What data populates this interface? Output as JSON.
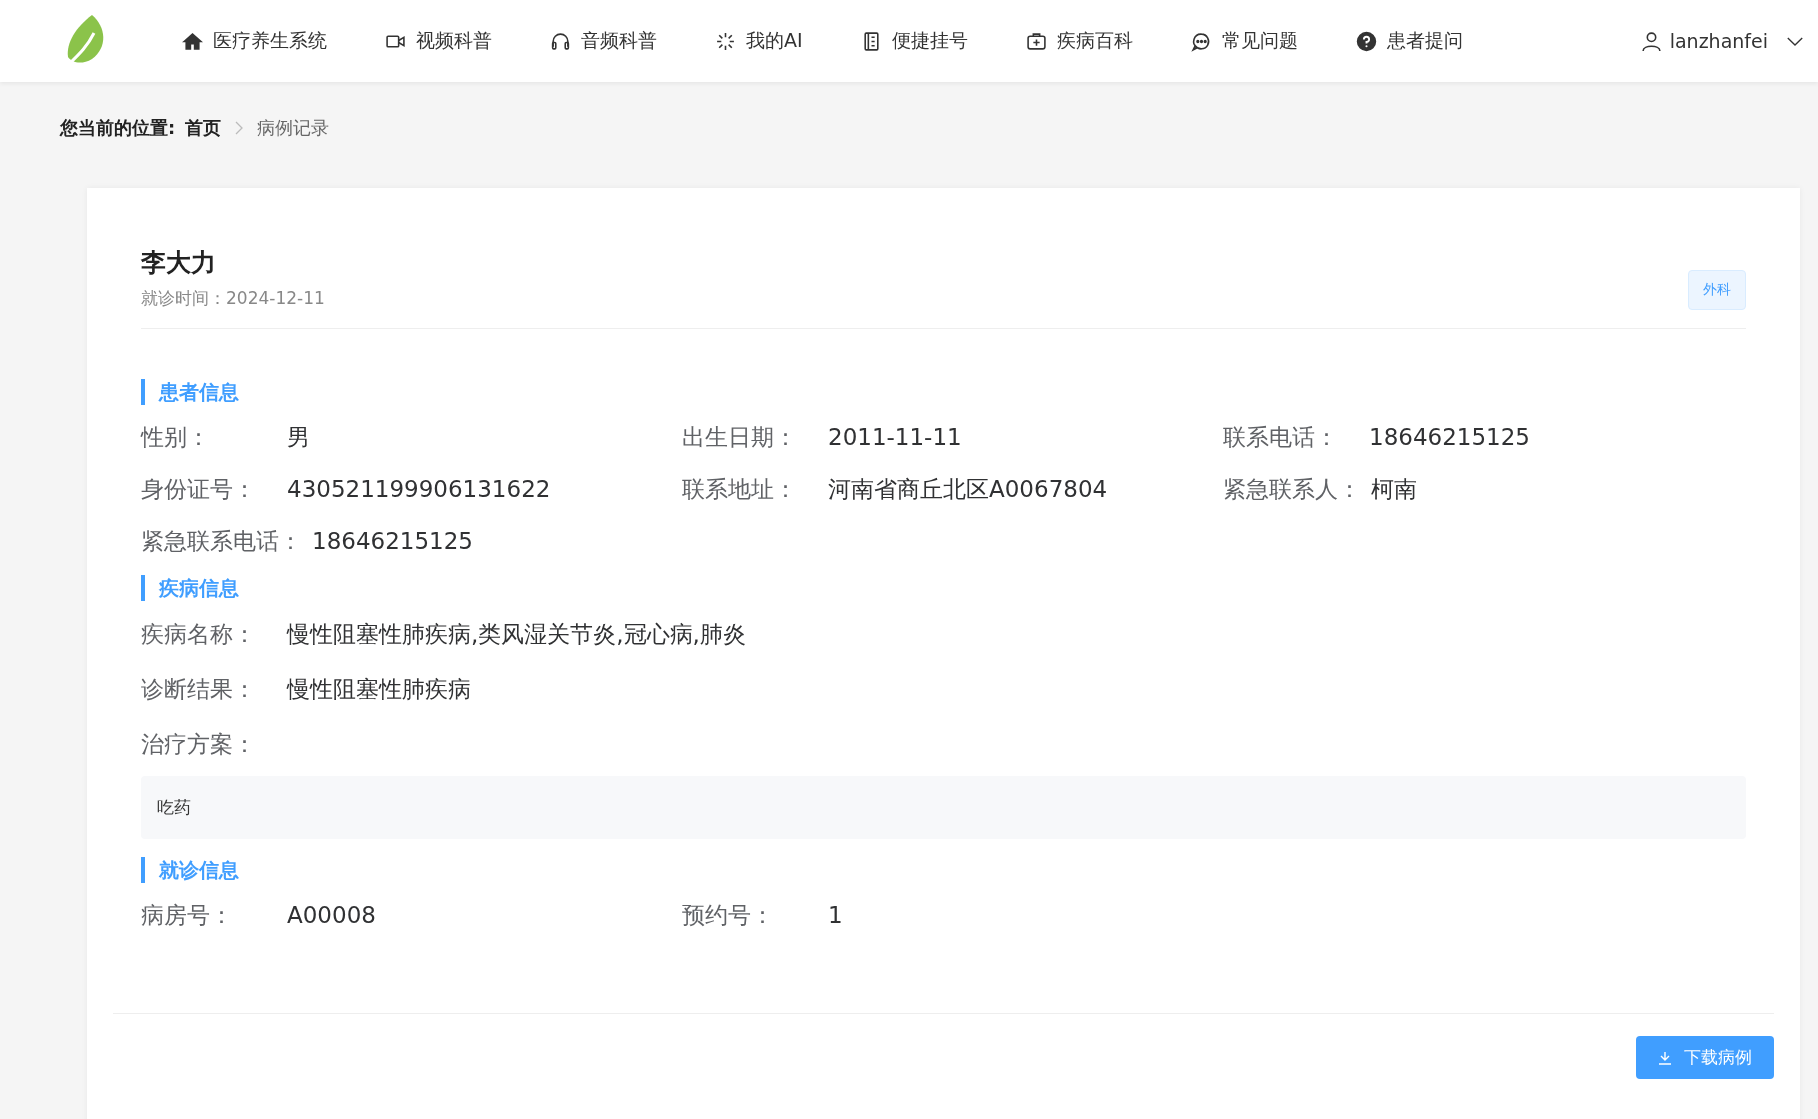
{
  "nav": {
    "items": [
      {
        "label": "医疗养生系统"
      },
      {
        "label": "视频科普"
      },
      {
        "label": "音频科普"
      },
      {
        "label": "我的AI"
      },
      {
        "label": "便捷挂号"
      },
      {
        "label": "疾病百科"
      },
      {
        "label": "常见问题"
      },
      {
        "label": "患者提问"
      }
    ],
    "user": "lanzhanfei"
  },
  "breadcrumb": {
    "prefix": "您当前的位置:",
    "home": "首页",
    "current": "病例记录"
  },
  "record": {
    "name": "李大力",
    "visit_time": "就诊时间：2024-12-11",
    "department": "外科",
    "sections": [
      {
        "title": "患者信息",
        "fields": [
          {
            "label": "性别：",
            "value": "男"
          },
          {
            "label": "出生日期：",
            "value": "2011-11-11"
          },
          {
            "label": "联系电话：",
            "value": "18646215125"
          },
          {
            "label": "身份证号：",
            "value": "430521199906131622"
          },
          {
            "label": "联系地址：",
            "value": "河南省商丘北区A0067804"
          },
          {
            "label": "紧急联系人：",
            "value": "柯南"
          },
          {
            "label": "紧急联系电话：",
            "value": "18646215125"
          }
        ]
      },
      {
        "title": "疾病信息",
        "rows": [
          {
            "label": "疾病名称：",
            "value": "慢性阻塞性肺疾病,类风湿关节炎,冠心病,肺炎"
          },
          {
            "label": "诊断结果：",
            "value": "慢性阻塞性肺疾病"
          },
          {
            "label": "治疗方案：",
            "box": "吃药"
          }
        ]
      },
      {
        "title": "就诊信息",
        "fields": [
          {
            "label": "病房号：",
            "value": "A00008"
          },
          {
            "label": "预约号：",
            "value": "1"
          }
        ]
      }
    ],
    "download_button": "下载病例"
  }
}
